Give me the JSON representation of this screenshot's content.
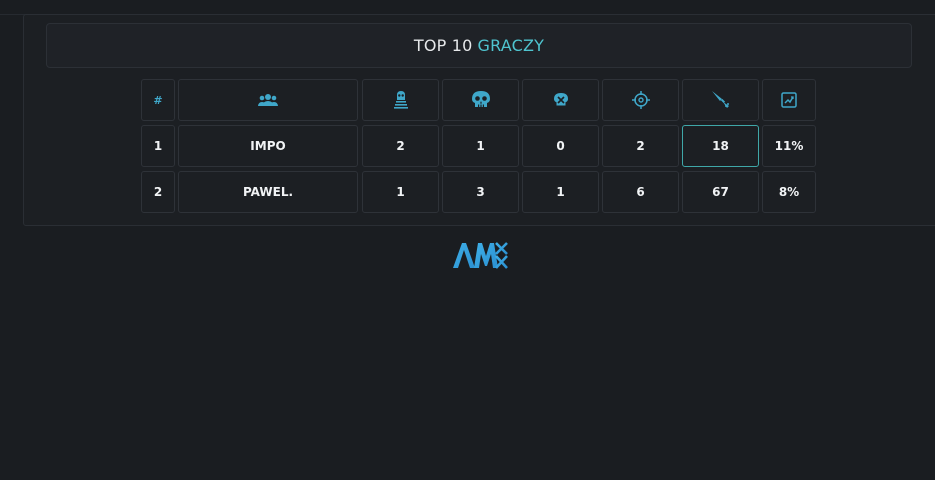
{
  "title": {
    "prefix": "TOP 10",
    "accent": "GRACZY"
  },
  "table": {
    "headers": {
      "rank": "#",
      "player_icon": "players-icon",
      "col3_icon": "tombstone-icon",
      "col4_icon": "skull-icon",
      "col5_icon": "skull-crosshair-icon",
      "col6_icon": "target-icon",
      "col7_icon": "knife-icon",
      "col8_icon": "chart-icon"
    },
    "rows": [
      {
        "rank": "1",
        "name": "IMPO",
        "c3": "2",
        "c4": "1",
        "c5": "0",
        "c6": "2",
        "c7": "18",
        "c8": "11%"
      },
      {
        "rank": "2",
        "name": "PAWEL.",
        "c3": "1",
        "c4": "3",
        "c5": "1",
        "c6": "6",
        "c7": "67",
        "c8": "8%"
      }
    ]
  },
  "colors": {
    "accent": "#4fc4cf",
    "icon": "#3fa7c9",
    "background": "#1a1d21"
  },
  "logo": {
    "text": "AMX",
    "icon": "amx-logo"
  }
}
